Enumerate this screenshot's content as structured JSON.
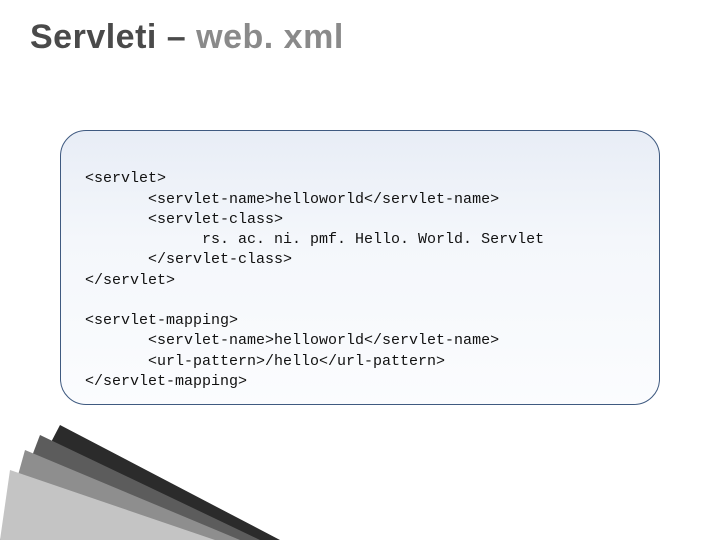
{
  "title": {
    "main": "Servleti – ",
    "accent": "web. xml"
  },
  "code": {
    "line1": "<servlet>",
    "line2": "       <servlet-name>helloworld</servlet-name>",
    "line3": "       <servlet-class>",
    "line4": "             rs. ac. ni. pmf. Hello. World. Servlet",
    "line5": "       </servlet-class>",
    "line6": "</servlet>",
    "blank": "",
    "line7": "<servlet-mapping>",
    "line8": "       <servlet-name>helloworld</servlet-name>",
    "line9": "       <url-pattern>/hello</url-pattern>",
    "line10": "</servlet-mapping>"
  }
}
